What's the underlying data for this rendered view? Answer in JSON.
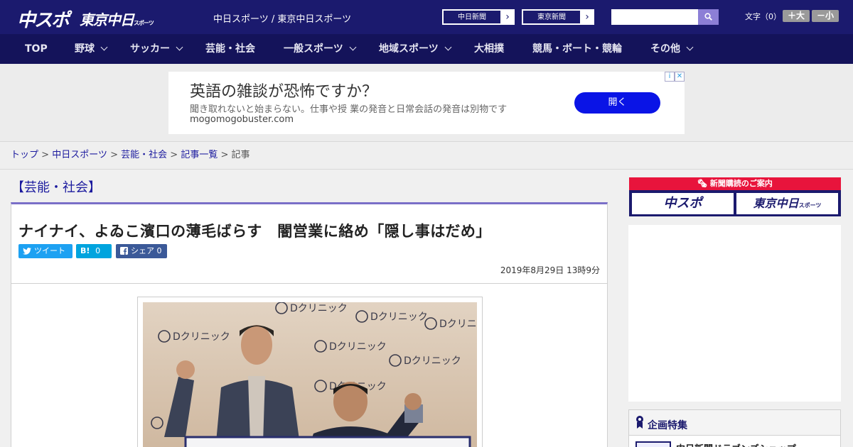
{
  "header": {
    "logo_main": "中スポ",
    "logo_tokyo": "東京中日",
    "logo_tokyo_sub": "スポーツ",
    "site_links": "中日スポーツ / 東京中日スポーツ",
    "paper_buttons": [
      "中日新聞",
      "東京新聞"
    ],
    "search_placeholder": "",
    "fontsize_label": "文字（0）",
    "fontsize_up": "＋大",
    "fontsize_down": "－小"
  },
  "nav": {
    "items": [
      {
        "label": "TOP"
      },
      {
        "label": "野球"
      },
      {
        "label": "サッカー"
      },
      {
        "label": "芸能・社会"
      },
      {
        "label": "一般スポーツ"
      },
      {
        "label": "地域スポーツ"
      },
      {
        "label": "大相撲"
      },
      {
        "label": "競馬・ボート・競輪"
      },
      {
        "label": "その他"
      }
    ]
  },
  "ad": {
    "title": "英語の雑談が恐怖ですか？",
    "description": "聞き取れないと始まらない。仕事や授 業の発音と日常会話の発音は別物です",
    "url": "mogomogobuster.com",
    "cta": "開く",
    "choice_icon": "i",
    "close_icon": "✕"
  },
  "breadcrumb": {
    "items": [
      "トップ",
      "中日スポーツ",
      "芸能・社会",
      "記事一覧"
    ],
    "current": "記事",
    "separator": ">"
  },
  "article": {
    "category": "【芸能・社会】",
    "headline": "ナイナイ、よゐこ濱口の薄毛ばらす　闇営業に絡め「隠し事はだめ」",
    "share": {
      "tweet": "ツイート",
      "hatena_label": "B!",
      "hatena_count": "0",
      "facebook_label": "シェア",
      "facebook_count": "0"
    },
    "date": "2019年8月29日 13時9分",
    "photo_backdrop_text": "Dクリニック"
  },
  "sidebar": {
    "subscribe_header": "新聞購読のご案内",
    "subscribe_logo_1": "中スポ",
    "subscribe_logo_2": "東京中日",
    "subscribe_logo_2_sub": "スポーツ",
    "feature_title": "企画特集",
    "feature_item": "中日新聞ドラゴンズショップ"
  },
  "colors": {
    "header_bg": "#1b1a6e",
    "nav_bg": "#14135a",
    "accent": "#7a6fc8",
    "ad_cta": "#0a14e6",
    "subscribe_red": "#e8143c"
  }
}
